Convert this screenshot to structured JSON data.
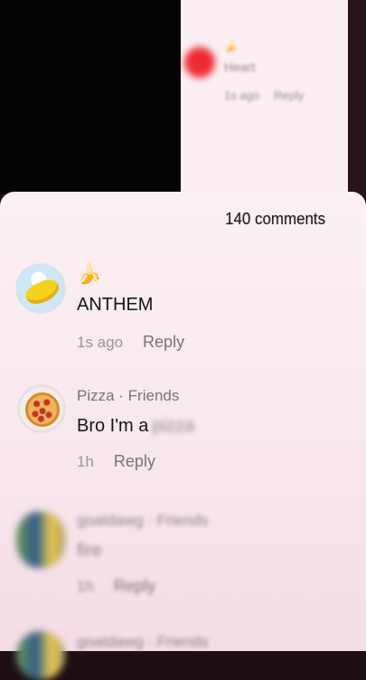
{
  "background_preview": {
    "emoji_line": "🍌",
    "text": "Heart",
    "time": "1s ago",
    "reply": "Reply"
  },
  "header": {
    "comments_count": "140 comments"
  },
  "comments": [
    {
      "name_emoji": "🍌",
      "text": "ANTHEM",
      "time": "1s ago",
      "reply": "Reply"
    },
    {
      "username": "Pizza · Friends",
      "text": "Bro I'm a",
      "text_blurred": "pizza",
      "time": "1h",
      "reply": "Reply"
    },
    {
      "username": "goatdawg · Friends",
      "text": "fire",
      "time": "1h",
      "reply": "Reply"
    },
    {
      "username": "goatdawg · Friends"
    }
  ]
}
